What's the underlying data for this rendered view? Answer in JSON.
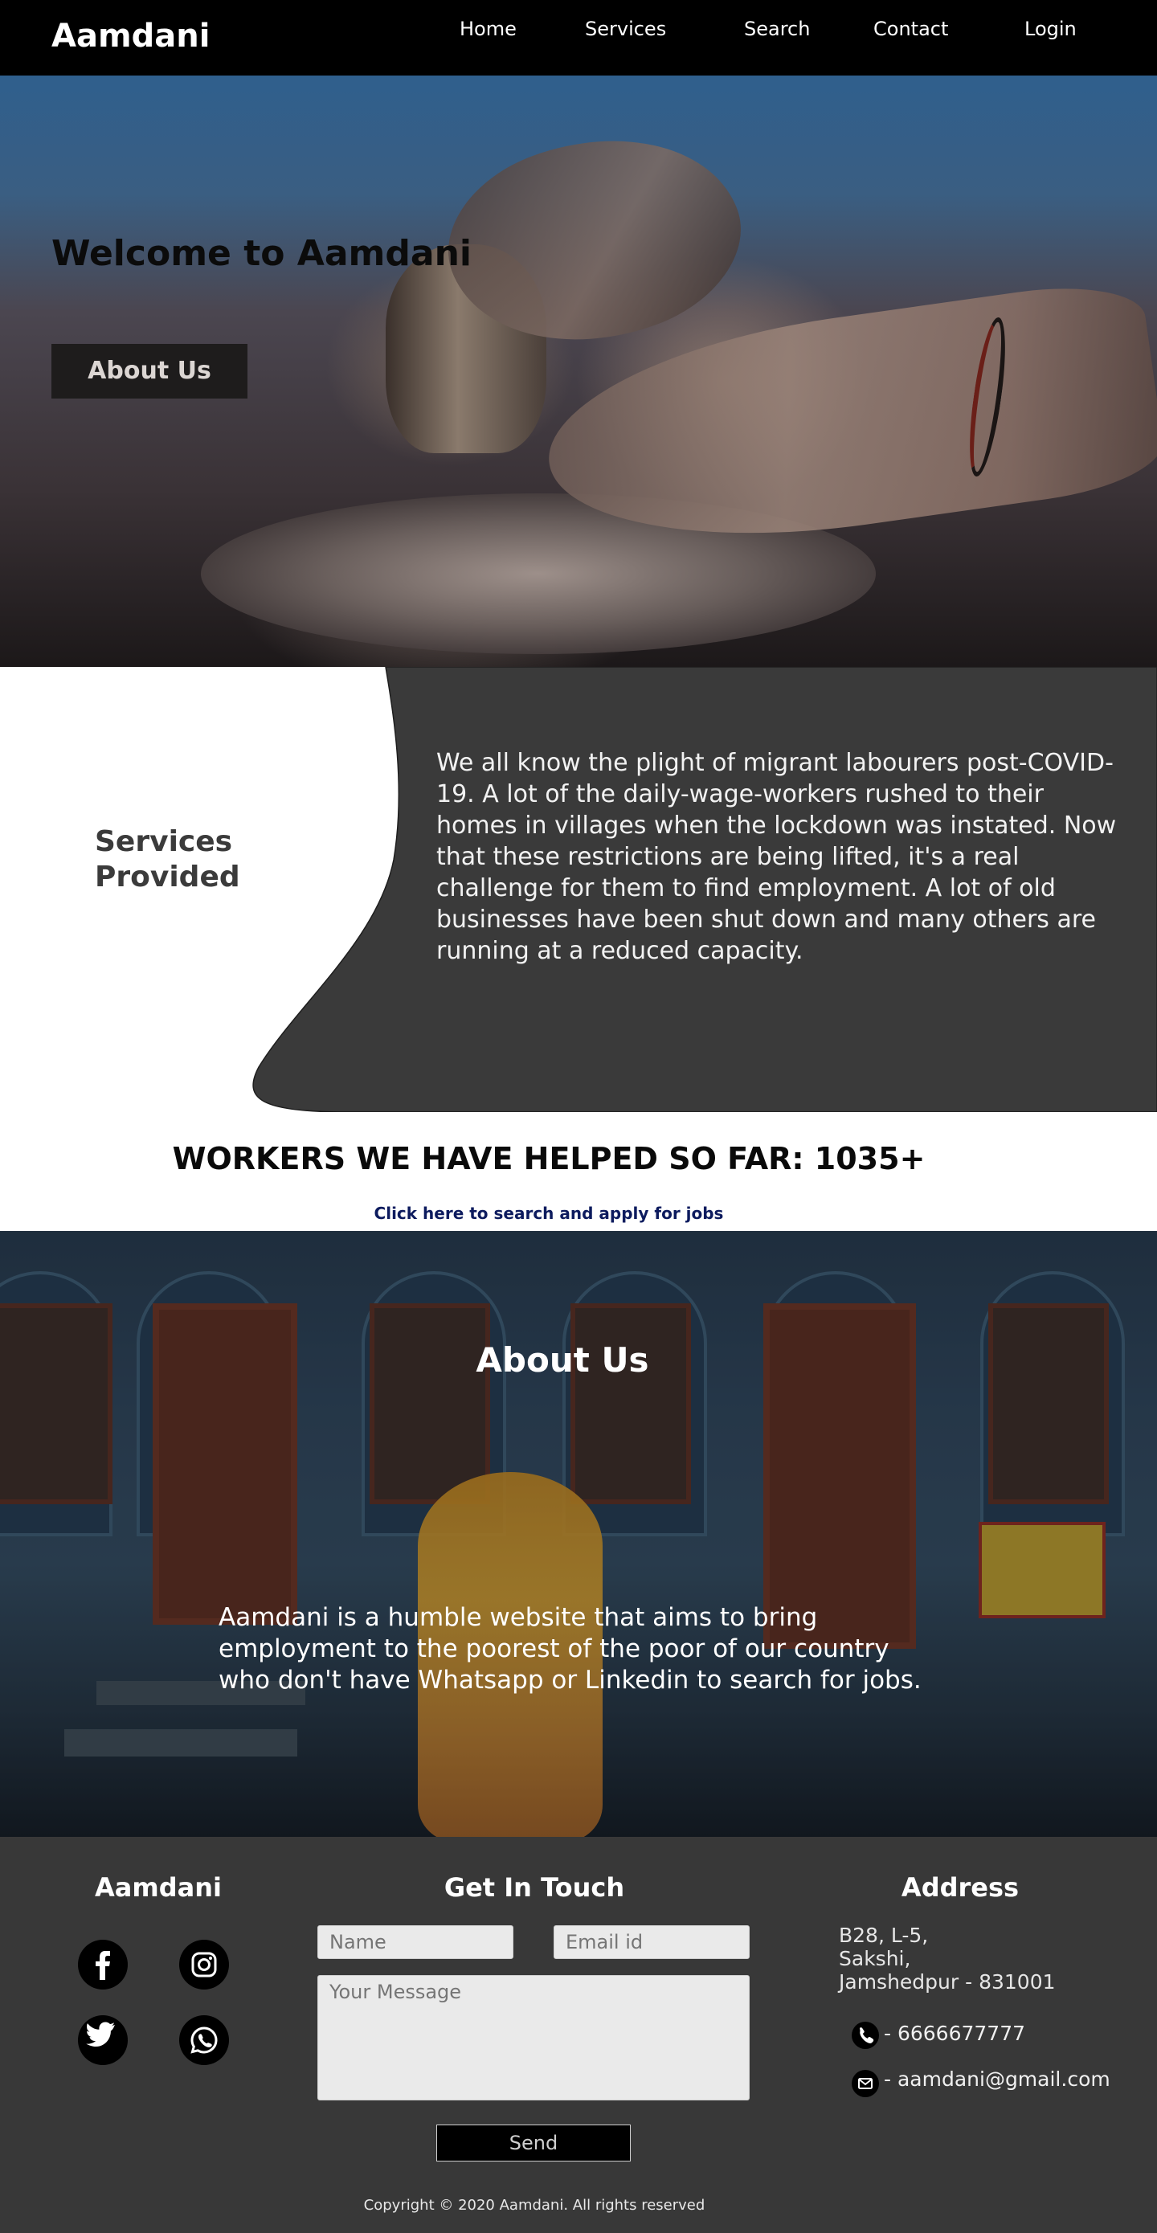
{
  "header": {
    "brand": "Aamdani",
    "nav": [
      "Home",
      "Services",
      "Search",
      "Contact",
      "Login"
    ]
  },
  "hero": {
    "title": "Welcome to Aamdani",
    "button_label": "About Us"
  },
  "services": {
    "title_line1": "Services",
    "title_line2": "Provided",
    "text": "We all know the plight of migrant labourers post-COVID-19. A lot of the daily-wage-workers rushed to their homes in villages when the lockdown was instated. Now that these restrictions are being lifted, it's a real challenge for them to find employment. A lot of old businesses have been shut down and many others are running at a reduced capacity."
  },
  "workers": {
    "title": "WORKERS WE HAVE HELPED SO FAR: 1035+",
    "link": "Click here to search and apply for jobs"
  },
  "about": {
    "title": "About Us",
    "text": "Aamdani is a humble website that aims to bring employment to the poorest of the poor of our country who don't have Whatsapp or Linkedin to search for jobs."
  },
  "footer": {
    "brand": "Aamdani",
    "social_icons": [
      "facebook-icon",
      "instagram-icon",
      "twitter-icon",
      "whatsapp-icon"
    ],
    "contact_title": "Get In Touch",
    "name_placeholder": "Name",
    "email_placeholder": "Email id",
    "message_placeholder": "Your Message",
    "send_label": "Send",
    "address_title": "Address",
    "address_lines": [
      "B28, L-5,",
      "Sakshi,",
      "Jamshedpur - 831001"
    ],
    "phone": "- 6666677777",
    "email": "- aamdani@gmail.com",
    "copyright": "Copyright © 2020 Aamdani. All rights reserved"
  },
  "colors": {
    "header_bg": "#000000",
    "dark_panel": "#383838",
    "link": "#0d1b5e"
  }
}
